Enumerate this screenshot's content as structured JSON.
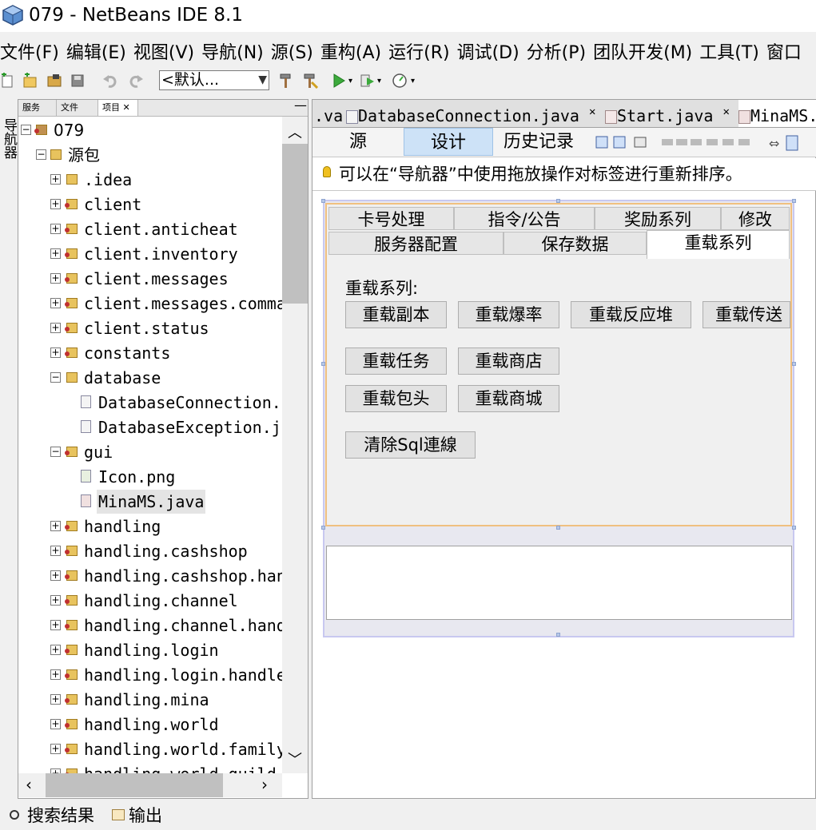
{
  "window": {
    "title": "079 - NetBeans IDE 8.1"
  },
  "menubar": [
    "文件(F)",
    "编辑(E)",
    "视图(V)",
    "导航(N)",
    "源(S)",
    "重构(A)",
    "运行(R)",
    "调试(D)",
    "分析(P)",
    "团队开发(M)",
    "工具(T)",
    "窗口"
  ],
  "toolbar": {
    "config_value": "<默认..."
  },
  "navigator_strip": {
    "label": "导航器"
  },
  "project_panel": {
    "tabs": [
      "服务",
      "文件",
      "项目"
    ],
    "tree": [
      "079",
      "源包",
      ".idea",
      "client",
      "client.anticheat",
      "client.inventory",
      "client.messages",
      "client.messages.comma",
      "client.status",
      "constants",
      "database",
      "DatabaseConnection.",
      "DatabaseException.j",
      "gui",
      "Icon.png",
      "MinaMS.java",
      "handling",
      "handling.cashshop",
      "handling.cashshop.han",
      "handling.channel",
      "handling.channel.hand",
      "handling.login",
      "handling.login.handle",
      "handling.mina",
      "handling.world",
      "handling.world.family",
      "handling.world.guild"
    ]
  },
  "editor": {
    "tabs": [
      ".va",
      "DatabaseConnection.java",
      "Start.java",
      "MinaMS."
    ],
    "view_tabs": [
      "源",
      "设计",
      "历史记录"
    ],
    "hint": "可以在“导航器”中使用拖放操作对标签进行重新排序。"
  },
  "form": {
    "tabs_row1": [
      "卡号处理",
      "指令/公告",
      "奖励系列",
      "修改"
    ],
    "tabs_row2": [
      "服务器配置",
      "保存数据",
      "重载系列"
    ],
    "section_label": "重载系列:",
    "buttons": [
      "重载副本",
      "重载爆率",
      "重载反应堆",
      "重载传送",
      "重载任务",
      "重载商店",
      "重载包头",
      "重载商城",
      "清除Sql連線"
    ]
  },
  "bottom": {
    "search_results": "搜索结果",
    "output": "输出"
  }
}
